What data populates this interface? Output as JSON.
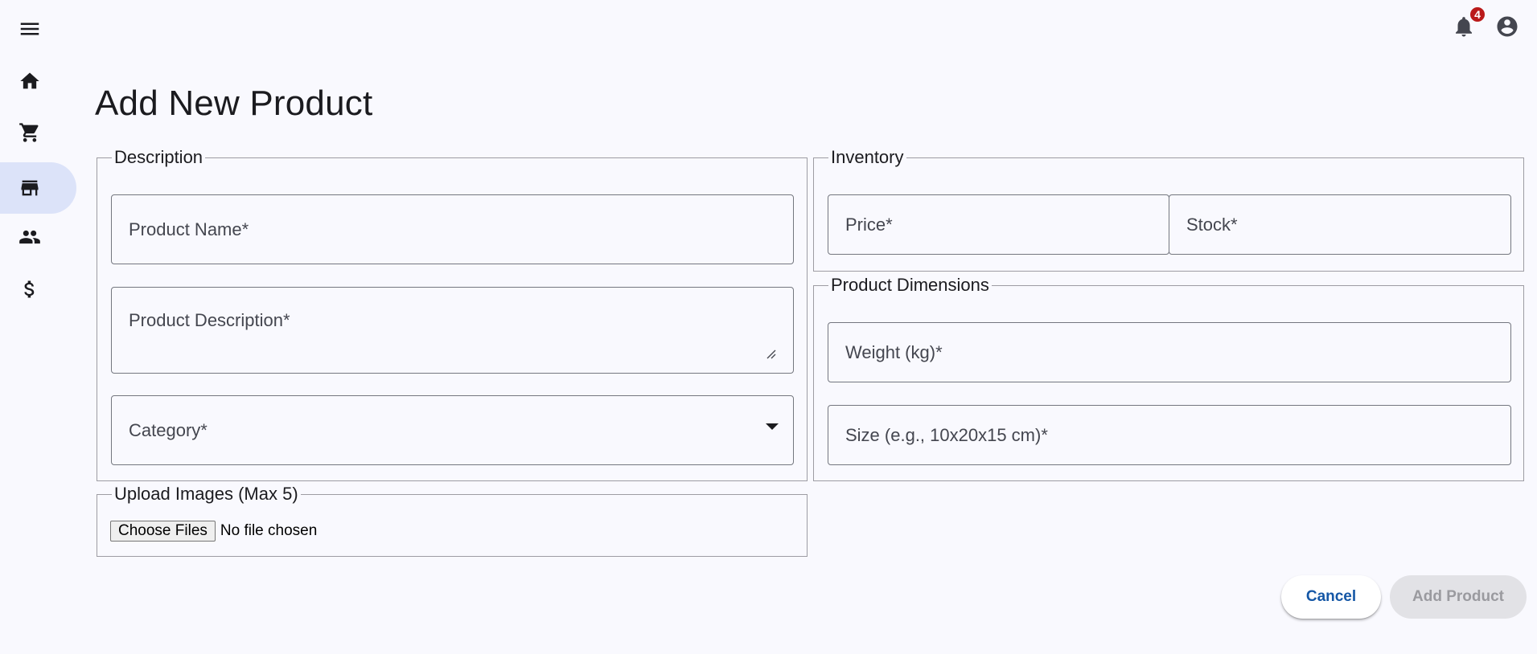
{
  "nav": {
    "items": [
      {
        "name": "menu",
        "icon": "menu-icon"
      },
      {
        "name": "home",
        "icon": "home-icon"
      },
      {
        "name": "cart",
        "icon": "shopping-cart-icon"
      },
      {
        "name": "store",
        "icon": "storefront-icon",
        "active": true
      },
      {
        "name": "users",
        "icon": "people-icon"
      },
      {
        "name": "finance",
        "icon": "dollar-icon"
      }
    ]
  },
  "header": {
    "notifications_count": "4",
    "notifications_icon": "bell-icon",
    "account_icon": "account-circle-icon"
  },
  "page": {
    "title": "Add New Product"
  },
  "form": {
    "description": {
      "legend": "Description",
      "product_name_label": "Product Name*",
      "product_description_label": "Product Description*",
      "category_label": "Category*"
    },
    "inventory": {
      "legend": "Inventory",
      "price_label": "Price*",
      "stock_label": "Stock*"
    },
    "dimensions": {
      "legend": "Product Dimensions",
      "weight_label": "Weight (kg)*",
      "size_label": "Size (e.g., 10x20x15 cm)*"
    },
    "upload": {
      "legend": "Upload Images (Max 5)",
      "button_label": "Choose Files",
      "status": "No file chosen"
    }
  },
  "actions": {
    "cancel_label": "Cancel",
    "add_label": "Add Product",
    "add_disabled": true
  },
  "colors": {
    "background": "#f9f9fe",
    "active_nav": "#dce3f9",
    "badge": "#ba1a1a",
    "cancel_text": "#1557a6",
    "disabled_button": "#e2e2e6"
  }
}
